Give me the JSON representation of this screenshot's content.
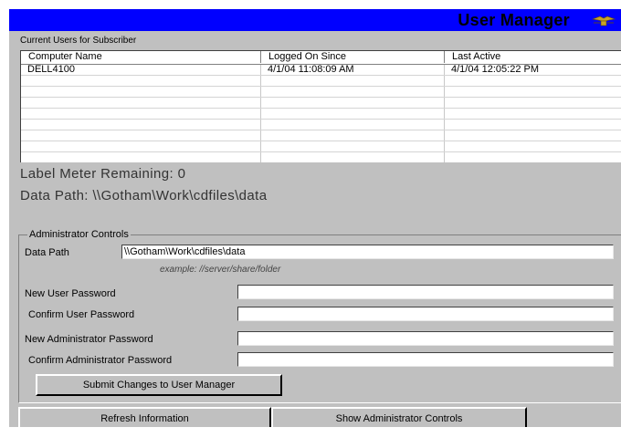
{
  "window": {
    "title": "User Manager",
    "logo_icon": "gold-eagle-logo-icon"
  },
  "users": {
    "caption": "Current Users for Subscriber",
    "columns": [
      "Computer Name",
      "Logged On Since",
      "Last Active"
    ],
    "rows": [
      [
        "DELL4100",
        "4/1/04 11:08:09 AM",
        "4/1/04 12:05:22 PM"
      ]
    ]
  },
  "status": {
    "label_meter": "Label Meter Remaining: 0",
    "data_path": "Data Path: \\\\Gotham\\Work\\cdfiles\\data"
  },
  "admin": {
    "group_label": "Administrator Controls",
    "data_path_label": "Data Path",
    "data_path_value": "\\\\Gotham\\Work\\cdfiles\\data",
    "example": "example: //server/share/folder",
    "new_user_password_label": "New User Password",
    "confirm_user_password_label": "Confirm User Password",
    "new_admin_password_label": "New Administrator Password",
    "confirm_admin_password_label": "Confirm Administrator Password",
    "submit_label": "Submit Changes to User Manager"
  },
  "footer": {
    "refresh_label": "Refresh Information",
    "show_admin_label": "Show Administrator Controls"
  },
  "colors": {
    "titlebar": "#0000ff",
    "face": "#c0c0c0"
  }
}
